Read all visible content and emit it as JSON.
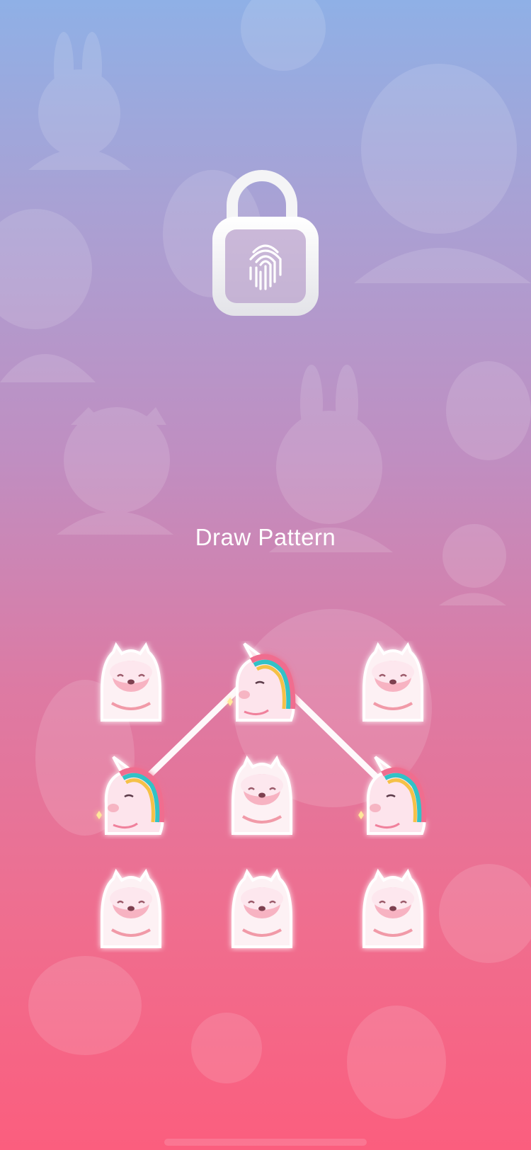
{
  "app": {
    "title": "Draw Pattern"
  },
  "lock": {
    "icon": "fingerprint-lock-icon",
    "state": "unlocked"
  },
  "pattern_grid": {
    "rows": 3,
    "cols": 3,
    "nodes": [
      {
        "icon": "alpaca-icon",
        "selected": false
      },
      {
        "icon": "unicorn-icon",
        "selected": true
      },
      {
        "icon": "alpaca-icon",
        "selected": false
      },
      {
        "icon": "unicorn-icon",
        "selected": true
      },
      {
        "icon": "alpaca-icon",
        "selected": false
      },
      {
        "icon": "unicorn-icon",
        "selected": true
      },
      {
        "icon": "alpaca-icon",
        "selected": false
      },
      {
        "icon": "alpaca-icon",
        "selected": false
      },
      {
        "icon": "alpaca-icon",
        "selected": false
      }
    ],
    "path_order": [
      3,
      1,
      5
    ]
  },
  "colors": {
    "gradient_top": "#8fb0e6",
    "gradient_bottom": "#fb5e7e",
    "node_fill": "#fce3ea",
    "line": "#ffffff"
  }
}
